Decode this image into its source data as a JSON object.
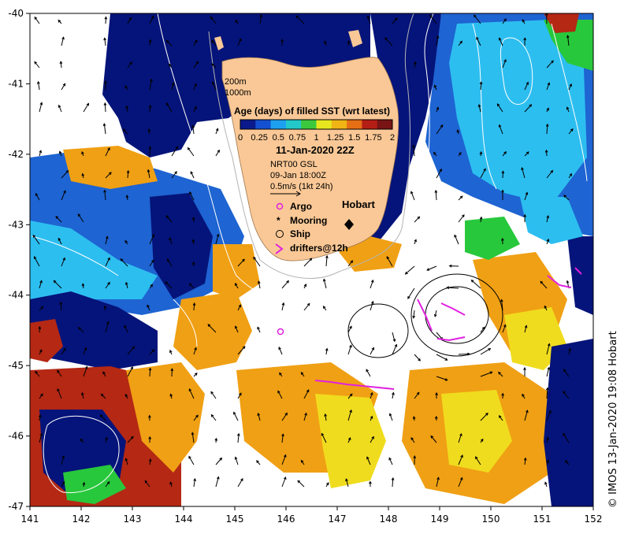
{
  "map": {
    "lon_range": [
      141,
      152
    ],
    "lat_range": [
      -47,
      -40
    ],
    "lon_ticks": [
      "141",
      "142",
      "143",
      "144",
      "145",
      "146",
      "147",
      "148",
      "149",
      "150",
      "151",
      "152"
    ],
    "lat_ticks": [
      "-40",
      "-41",
      "-42",
      "-43",
      "-44",
      "-45",
      "-46",
      "-47"
    ]
  },
  "legend": {
    "depth_200": "200m",
    "depth_1000": "1000m",
    "colorbar_title": "Age (days) of filled SST (wrt latest)",
    "colorbar_ticks": [
      "0",
      "0.25",
      "0.5",
      "0.75",
      "1",
      "1.25",
      "1.5",
      "1.75",
      "2"
    ],
    "colorbar_colors": [
      "#0a1a8c",
      "#1450d2",
      "#1ea0f0",
      "#23c8c8",
      "#3cc83c",
      "#e6e61e",
      "#f0b414",
      "#e66e14",
      "#b41e14",
      "#781414"
    ],
    "date": "11-Jan-2020 22Z",
    "currents_source": "NRT00 GSL",
    "currents_date": "09-Jan 18:00Z",
    "vector_scale": "0.5m/s (1kt 24h)",
    "symbols": [
      {
        "icon": "argo-icon",
        "label": "Argo",
        "color": "#e020e0"
      },
      {
        "icon": "mooring-icon",
        "label": "Mooring",
        "color": "#000000"
      },
      {
        "icon": "ship-icon",
        "label": "Ship",
        "color": "#000000"
      },
      {
        "icon": "drifter-icon",
        "label": "drifters@12h",
        "color": "#e020e0"
      }
    ]
  },
  "place_label": "Hobart",
  "credit": "© IMOS 13-Jan-2020 19:08 Hobart",
  "palette": {
    "land": "#fac896",
    "navy": "#05147a",
    "blue": "#1e64d2",
    "cyan": "#2dbef0",
    "green": "#28c83c",
    "yellow": "#f0dc1e",
    "orange": "#f0a014",
    "red": "#b42814",
    "drifter": "#e020e0"
  }
}
